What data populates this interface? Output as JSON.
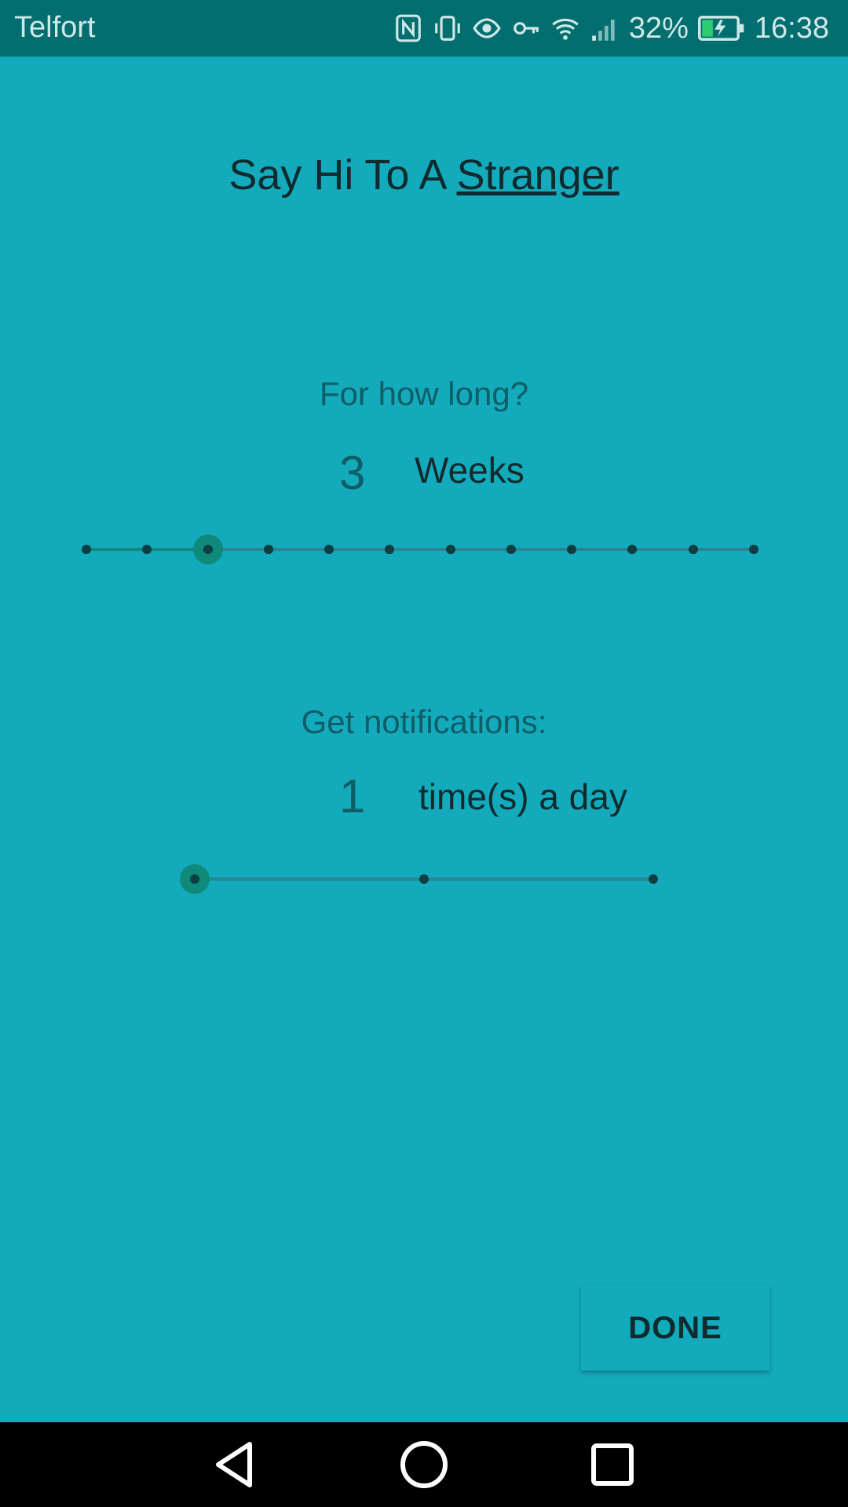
{
  "status_bar": {
    "carrier": "Telfort",
    "battery_percent": "32%",
    "time": "16:38",
    "icons": [
      "nfc-icon",
      "vibrate-icon",
      "eye-icon",
      "key-icon",
      "wifi-icon",
      "signal-icon",
      "battery-charging-icon"
    ],
    "battery_level": 0.32
  },
  "title": {
    "prefix": "Say Hi To A ",
    "emphasis": "Stranger"
  },
  "duration": {
    "label": "For how long?",
    "value": "3",
    "unit": "Weeks",
    "slider": {
      "min": 1,
      "max": 12,
      "value": 3
    }
  },
  "notifications": {
    "label": "Get notifications:",
    "value": "1",
    "unit": "time(s) a day",
    "slider": {
      "min": 1,
      "max": 3,
      "value": 1
    }
  },
  "done_label": "DONE",
  "nav": [
    "back-icon",
    "home-icon",
    "recents-icon"
  ],
  "colors": {
    "background": "#13aabb",
    "status_bar": "#006e6e",
    "accent": "#0f8a7a"
  }
}
